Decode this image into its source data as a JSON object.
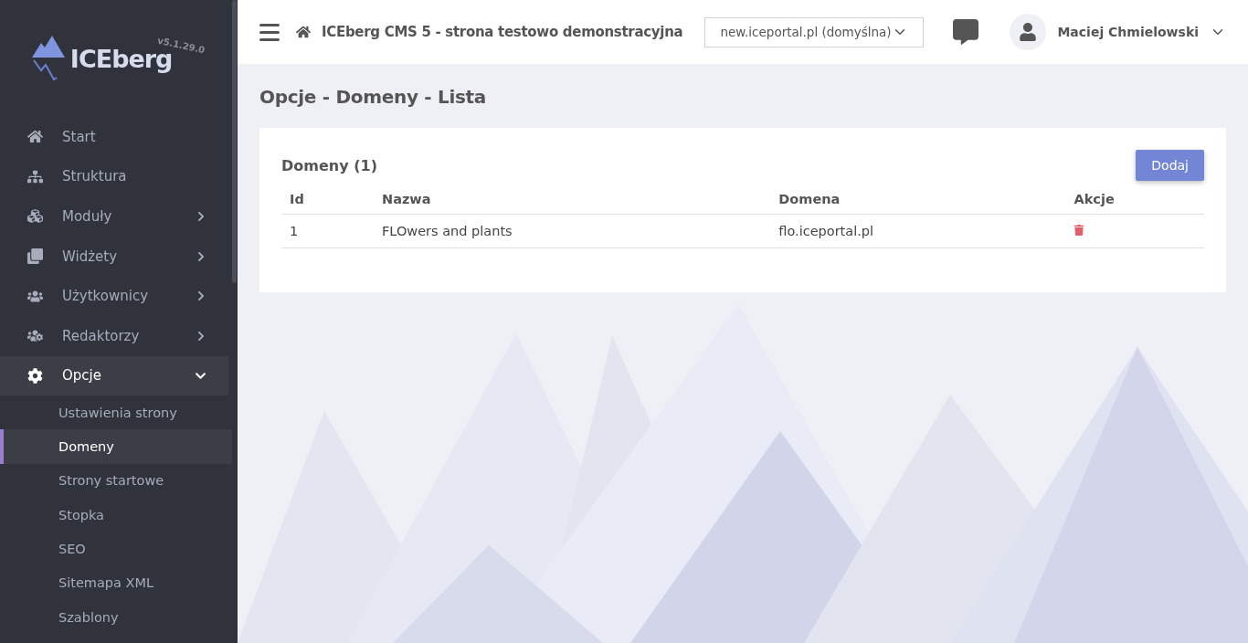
{
  "sidebar": {
    "logo": {
      "name": "ICEberg",
      "version": "v5.1.29.0"
    },
    "items": [
      {
        "label": "Start",
        "selected": false
      },
      {
        "label": "Struktura",
        "selected": false
      },
      {
        "label": "Moduły",
        "expanded": false,
        "selected": false
      },
      {
        "label": "Widżety",
        "expanded": false,
        "selected": false
      },
      {
        "label": "Użytkownicy",
        "expanded": false,
        "selected": false
      },
      {
        "label": "Redaktorzy",
        "expanded": false,
        "selected": false
      },
      {
        "label": "Opcje",
        "expanded": true,
        "selected": true,
        "children": [
          {
            "label": "Ustawienia strony",
            "selected": false
          },
          {
            "label": "Domeny",
            "selected": true
          },
          {
            "label": "Strony startowe",
            "selected": false
          },
          {
            "label": "Stopka",
            "selected": false
          },
          {
            "label": "SEO",
            "selected": false
          },
          {
            "label": "Sitemapa XML",
            "selected": false
          },
          {
            "label": "Szablony",
            "selected": false
          }
        ]
      }
    ]
  },
  "topbar": {
    "site_title": "ICEberg CMS 5 - strona testowo demonstracyjna",
    "domain_select": {
      "value": "new.iceportal.pl (domyślna)"
    },
    "user": "Maciej Chmielowski"
  },
  "page_title": "Opcje - Domeny - Lista",
  "card": {
    "title": "Domeny (1)",
    "add_button": "Dodaj",
    "table": {
      "columns": [
        "Id",
        "Nazwa",
        "Domena",
        "Akcje"
      ],
      "rows": [
        {
          "id": "1",
          "name": "FLOwers and plants",
          "domain": "flo.iceportal.pl"
        }
      ]
    }
  }
}
